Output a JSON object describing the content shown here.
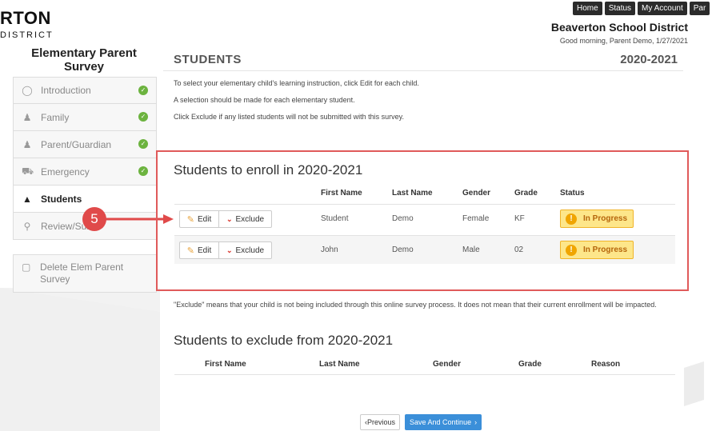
{
  "header": {
    "logo_title": "RTON",
    "logo_sub": "DISTRICT",
    "nav": [
      "Home",
      "Status",
      "My Account",
      "Par"
    ],
    "district_name": "Beaverton School District",
    "greeting": "Good morning, Parent Demo, 1/27/2021"
  },
  "sidebar": {
    "survey_title": "Elementary Parent Survey",
    "items": [
      {
        "label": "Introduction",
        "icon": "lightbulb-icon",
        "complete": true
      },
      {
        "label": "Family",
        "icon": "users-icon",
        "complete": true
      },
      {
        "label": "Parent/Guardian",
        "icon": "user-icon",
        "complete": true
      },
      {
        "label": "Emergency",
        "icon": "ambulance-icon",
        "complete": true
      },
      {
        "label": "Students",
        "icon": "graduation-cap-icon",
        "complete": false
      },
      {
        "label": "Review/Sub",
        "icon": "search-icon",
        "complete": false
      }
    ],
    "delete_label": "Delete Elem Parent Survey"
  },
  "annotation": {
    "step": "5"
  },
  "main": {
    "title": "STUDENTS",
    "year": "2020-2021",
    "instructions": [
      "To select your elementary child's learning instruction, click Edit for each child.",
      "A selection should be made for each elementary student.",
      "Click Exclude if any listed students will not be submitted with this survey."
    ],
    "enroll": {
      "title": "Students to enroll in 2020-2021",
      "columns": [
        "First Name",
        "Last Name",
        "Gender",
        "Grade",
        "Status"
      ],
      "edit_label": "Edit",
      "exclude_label": "Exclude",
      "rows": [
        {
          "first": "Student",
          "last": "Demo",
          "gender": "Female",
          "grade": "KF",
          "status": "In Progress"
        },
        {
          "first": "John",
          "last": "Demo",
          "gender": "Male",
          "grade": "02",
          "status": "In Progress"
        }
      ]
    },
    "note": "\"Exclude\" means that your child is not being included through this online survey process. It does not mean that their current enrollment will be impacted.",
    "exclude": {
      "title": "Students to exclude from 2020-2021",
      "columns": [
        "First Name",
        "Last Name",
        "Gender",
        "Grade",
        "Reason"
      ]
    }
  },
  "footer": {
    "previous_label": "Previous",
    "save_label": "Save And Continue"
  },
  "colors": {
    "accent_red": "#e05a5a",
    "complete_green": "#6cb33f",
    "status_yellow": "#fde68a",
    "save_blue": "#3b8fd9"
  }
}
